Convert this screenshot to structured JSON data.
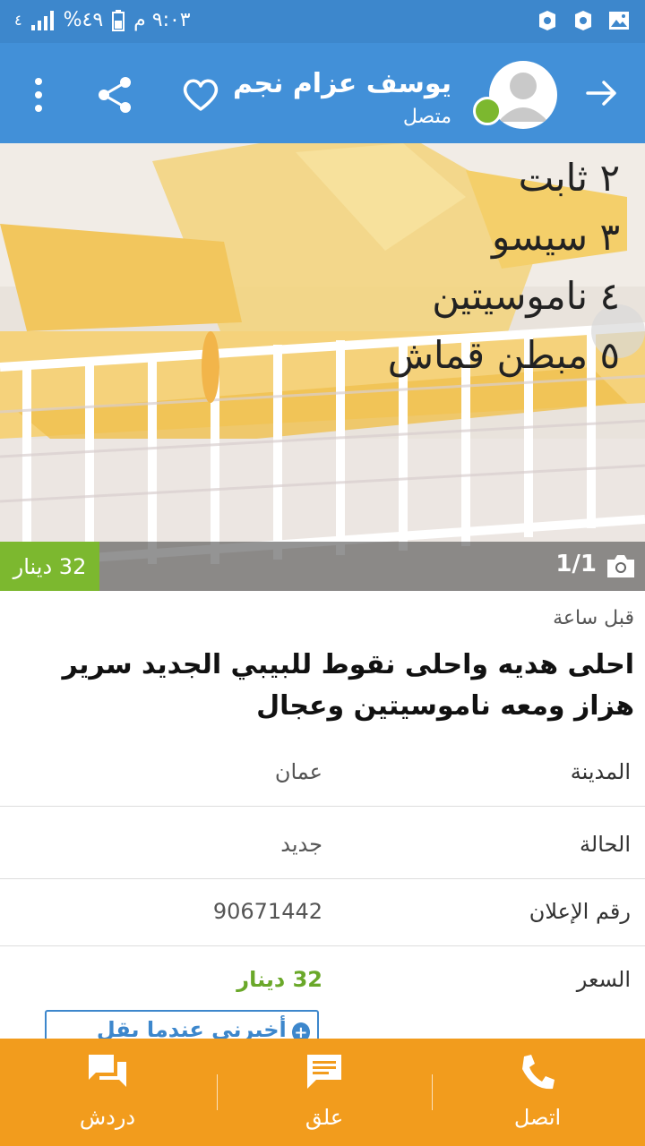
{
  "status_bar": {
    "time": "٩:٠٣ م",
    "battery": "٤٩%",
    "signal": "٤"
  },
  "app_bar": {
    "user_name": "يوسف عزام نجم",
    "user_status": "متصل",
    "colors": {
      "bar": "#4290d8",
      "online": "#7cb82f"
    }
  },
  "photo": {
    "overlay_lines": [
      "٢ ثابت",
      "٣ سيسو",
      "٤ ناموسيتين",
      "٥ مبطن قماش"
    ],
    "counter": "1/1",
    "price_badge": "32 دينار"
  },
  "listing": {
    "time_ago": "قبل ساعة",
    "title": "احلى هديه واحلى نقوط  للبيبي الجديد  سرير هزاز ومعه ناموسيتين وعجال",
    "details": [
      {
        "label": "المدينة",
        "value": "عمان"
      },
      {
        "label": "الحالة",
        "value": "جديد"
      },
      {
        "label": "رقم الإعلان",
        "value": "90671442"
      },
      {
        "label": "السعر",
        "value": "32 دينار"
      }
    ],
    "notify_button": "أخبرني عندما يقل السعر"
  },
  "bottom_bar": {
    "call": "اتصل",
    "comment": "علق",
    "chat": "دردش",
    "color": "#f29c1d"
  }
}
